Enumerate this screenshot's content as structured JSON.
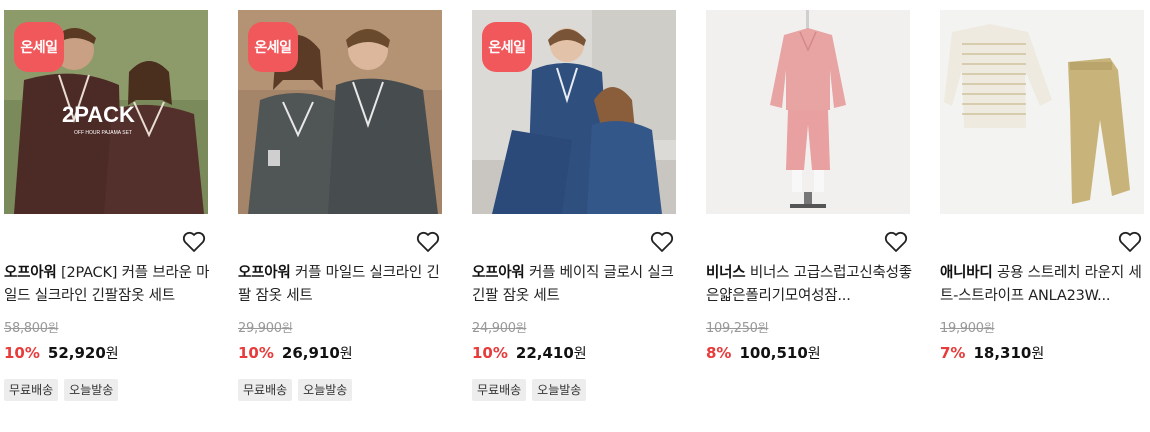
{
  "products": [
    {
      "badge": "온세일",
      "brand": "오프아워",
      "name": "[2PACK] 커플 브라운 마일드 실크라인 긴팔잠옷 세트",
      "original_price": "58,800",
      "discount": "10%",
      "price": "52,920",
      "tags": [
        "무료배송",
        "오늘발송"
      ],
      "image_text": "2PACK",
      "image_subtext": "OFF HOUR PAJAMA SET"
    },
    {
      "badge": "온세일",
      "brand": "오프아워",
      "name": "커플 마일드 실크라인 긴팔 잠옷 세트",
      "original_price": "29,900",
      "discount": "10%",
      "price": "26,910",
      "tags": [
        "무료배송",
        "오늘발송"
      ]
    },
    {
      "badge": "온세일",
      "brand": "오프아워",
      "name": "커플 베이직 글로시 실크 긴팔 잠옷 세트",
      "original_price": "24,900",
      "discount": "10%",
      "price": "22,410",
      "tags": [
        "무료배송",
        "오늘발송"
      ]
    },
    {
      "brand": "비너스",
      "name": "비너스 고급스럽고신축성좋은얇은폴리기모여성잠...",
      "original_price": "109,250",
      "discount": "8%",
      "price": "100,510"
    },
    {
      "brand": "애니바디",
      "name": "공용 스트레치 라운지 세트-스트라이프 ANLA23W...",
      "original_price": "19,900",
      "discount": "7%",
      "price": "18,310"
    }
  ],
  "currency_unit": "원",
  "colors": {
    "badge": "#f0585b",
    "discount": "#e83b3b",
    "tag_bg": "#ededed"
  }
}
